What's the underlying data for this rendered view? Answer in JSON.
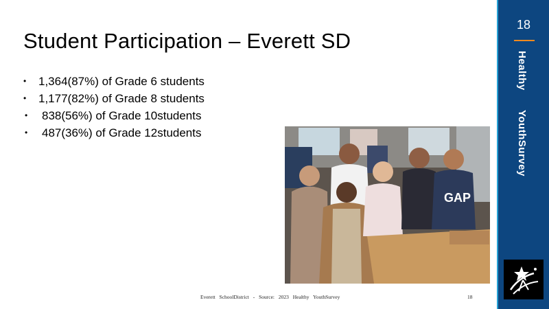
{
  "title": "Student Participation – Everett SD",
  "bullets": [
    "1,364(87%) of Grade 6 students",
    "1,177(82%) of Grade 8 students",
    "838(56%) of Grade 10students",
    "487(36%) of Grade 12students"
  ],
  "bullet_glyph": "•",
  "footer": {
    "text": "Everett SchoolDistrict - Source: 2023 Healthy YouthSurvey",
    "page": "18"
  },
  "sidebar": {
    "page_number": "18",
    "word1": "Healthy",
    "word2": "YouthSurvey",
    "colors": {
      "background": "#0d4680",
      "accent_line": "#f0891e",
      "border": "#27a3d6"
    }
  },
  "photo": {
    "description_icon": "group-photo-image"
  },
  "logo": {
    "icon": "star-figure-logo-icon"
  }
}
